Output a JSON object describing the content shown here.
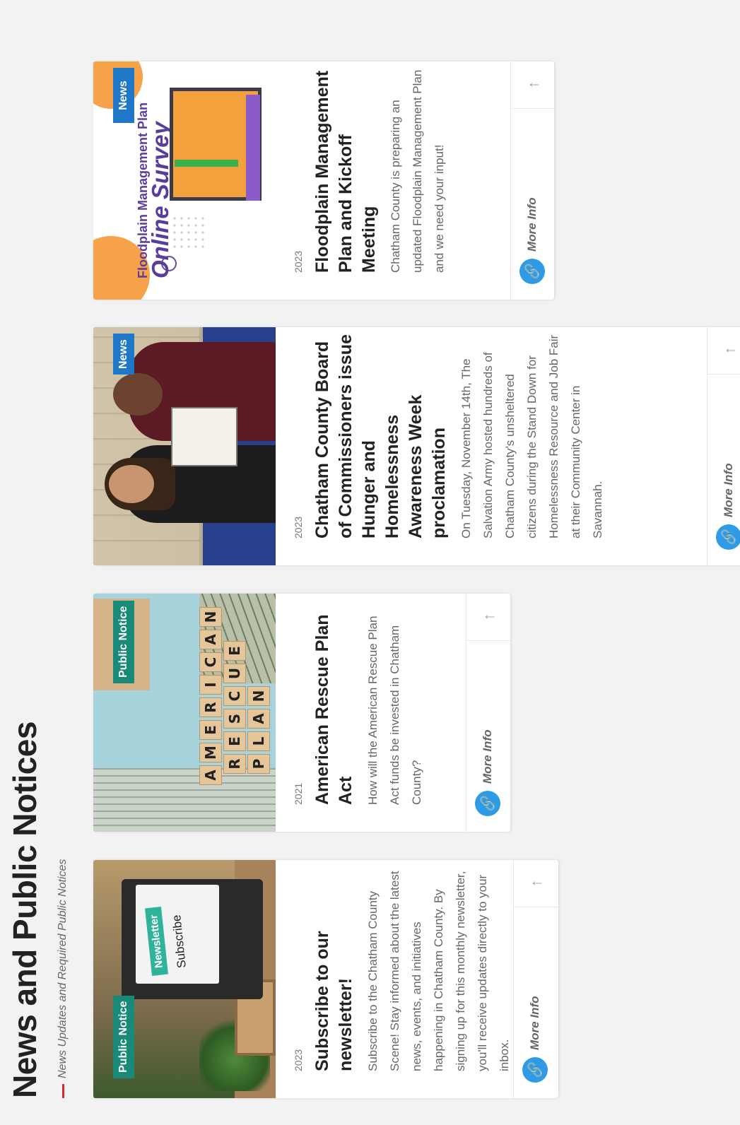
{
  "page": {
    "title": "News and Public Notices",
    "subtitle": "News Updates and Required Public Notices"
  },
  "cards": [
    {
      "tag": "Public Notice",
      "year": "2023",
      "title": "Subscribe to our newsletter!",
      "description": "Subscribe to the Chatham County Scene! Stay informed about the latest news, events, and initiatives happening in Chatham County. By signing up for this monthly newsletter, you'll receive updates directly to your inbox.",
      "more_label": "More Info",
      "image_text": [
        "Newsletter",
        "Subscribe"
      ]
    },
    {
      "tag": "Public Notice",
      "year": "2021",
      "title": "American Rescue Plan Act",
      "description": "How will the American Rescue Plan Act funds be invested in Chatham County?",
      "more_label": "More Info",
      "image_text": [
        "AMERICAN",
        "RESCUE",
        "PLAN"
      ]
    },
    {
      "tag": "News",
      "year": "2023",
      "title": "Chatham County Board of Commissioners issue Hunger and Homelessness Awareness Week proclamation",
      "description": "On Tuesday, November 14th, The Salvation Army hosted hundreds of Chatham County's unsheltered citizens during the Stand Down for Homelessness Resource and Job Fair at their Community Center in Savannah.",
      "more_label": "More Info"
    },
    {
      "tag": "News",
      "year": "2023",
      "title": "Floodplain Management Plan and Kickoff Meeting",
      "description": "Chatham County is preparing an updated Floodplain Management Plan and we need your input!",
      "more_label": "More Info",
      "image_text": [
        "Floodplain Management Plan",
        "Online Survey"
      ]
    }
  ],
  "colors": {
    "accent_red": "#d6262f",
    "badge_public_notice": "#1a8a78",
    "badge_news": "#1f77c8",
    "link_icon": "#2f9ae6"
  },
  "icons": {
    "link": "link-icon",
    "up": "arrow-up-icon"
  }
}
